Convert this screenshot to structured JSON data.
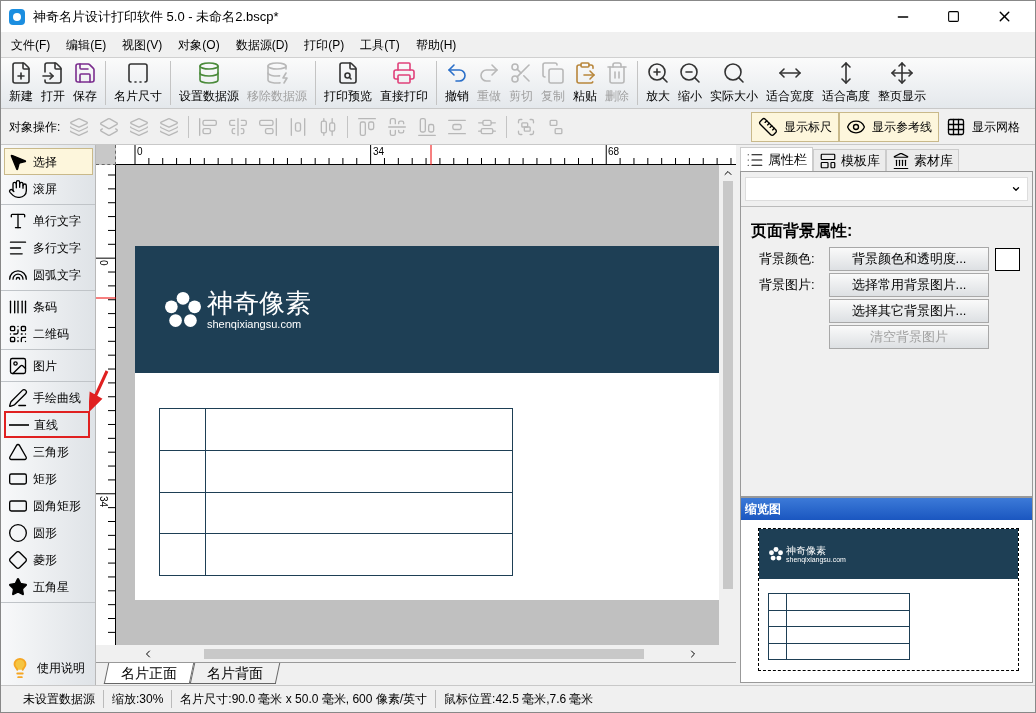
{
  "window": {
    "title": "神奇名片设计打印软件 5.0 - 未命名2.bscp*"
  },
  "menu": [
    "文件(F)",
    "编辑(E)",
    "视图(V)",
    "对象(O)",
    "数据源(D)",
    "打印(P)",
    "工具(T)",
    "帮助(H)"
  ],
  "toolbar": [
    [
      {
        "label": "新建",
        "disabled": false
      },
      {
        "label": "打开",
        "disabled": false
      },
      {
        "label": "保存",
        "disabled": false
      }
    ],
    [
      {
        "label": "名片尺寸",
        "disabled": false
      }
    ],
    [
      {
        "label": "设置数据源",
        "disabled": false
      },
      {
        "label": "移除数据源",
        "disabled": true
      }
    ],
    [
      {
        "label": "打印预览",
        "disabled": false
      },
      {
        "label": "直接打印",
        "disabled": false
      }
    ],
    [
      {
        "label": "撤销",
        "disabled": false
      },
      {
        "label": "重做",
        "disabled": true
      },
      {
        "label": "剪切",
        "disabled": true
      },
      {
        "label": "复制",
        "disabled": true
      },
      {
        "label": "粘贴",
        "disabled": false
      },
      {
        "label": "删除",
        "disabled": true
      }
    ],
    [
      {
        "label": "放大",
        "disabled": false
      },
      {
        "label": "缩小",
        "disabled": false
      },
      {
        "label": "实际大小",
        "disabled": false
      },
      {
        "label": "适合宽度",
        "disabled": false
      },
      {
        "label": "适合高度",
        "disabled": false
      },
      {
        "label": "整页显示",
        "disabled": false
      }
    ]
  ],
  "object_toolbar": {
    "label": "对象操作:",
    "groups": [
      [
        {
          "disabled": true
        },
        {
          "disabled": true
        },
        {
          "disabled": true
        },
        {
          "disabled": true
        }
      ],
      [
        {
          "disabled": true
        },
        {
          "disabled": true
        },
        {
          "disabled": true
        },
        {
          "disabled": true
        },
        {
          "disabled": true
        }
      ],
      [
        {
          "disabled": true
        },
        {
          "disabled": true
        },
        {
          "disabled": true
        },
        {
          "disabled": true
        },
        {
          "disabled": true
        }
      ],
      [
        {
          "disabled": true
        },
        {
          "disabled": true
        }
      ]
    ]
  },
  "view_toggles": [
    {
      "label": "显示标尺",
      "on": true
    },
    {
      "label": "显示参考线",
      "on": true
    },
    {
      "label": "显示网格",
      "on": false
    }
  ],
  "tools": [
    [
      {
        "label": "选择",
        "selected": true,
        "highlighted": false
      },
      {
        "label": "滚屏",
        "selected": false,
        "highlighted": false
      }
    ],
    [
      {
        "label": "单行文字",
        "selected": false,
        "highlighted": false
      },
      {
        "label": "多行文字",
        "selected": false,
        "highlighted": false
      },
      {
        "label": "圆弧文字",
        "selected": false,
        "highlighted": false
      }
    ],
    [
      {
        "label": "条码",
        "selected": false,
        "highlighted": false
      },
      {
        "label": "二维码",
        "selected": false,
        "highlighted": false
      }
    ],
    [
      {
        "label": "图片",
        "selected": false,
        "highlighted": false
      }
    ],
    [
      {
        "label": "手绘曲线",
        "selected": false,
        "highlighted": false
      },
      {
        "label": "直线",
        "selected": false,
        "highlighted": true
      },
      {
        "label": "三角形",
        "selected": false,
        "highlighted": false
      },
      {
        "label": "矩形",
        "selected": false,
        "highlighted": false
      },
      {
        "label": "圆角矩形",
        "selected": false,
        "highlighted": false
      },
      {
        "label": "圆形",
        "selected": false,
        "highlighted": false
      },
      {
        "label": "菱形",
        "selected": false,
        "highlighted": false
      },
      {
        "label": "五角星",
        "selected": false,
        "highlighted": false
      }
    ]
  ],
  "help_button": "使用说明",
  "rulers": {
    "horizontal": [
      "0",
      "34",
      "68"
    ],
    "vertical": [
      "0",
      "34"
    ]
  },
  "card": {
    "logo_text": "神奇像素",
    "logo_url": "shenqixiangsu.com"
  },
  "sheet_tabs": [
    {
      "label": "名片正面",
      "selected": true
    },
    {
      "label": "名片背面",
      "selected": false
    }
  ],
  "panel_tabs": [
    {
      "label": "属性栏",
      "selected": true
    },
    {
      "label": "模板库",
      "selected": false
    },
    {
      "label": "素材库",
      "selected": false
    }
  ],
  "properties": {
    "heading": "页面背景属性:",
    "rows": [
      {
        "label": "背景颜色:",
        "button": "背景颜色和透明度...",
        "disabled": false,
        "has_swatch": true
      },
      {
        "label": "背景图片:",
        "button": "选择常用背景图片...",
        "disabled": false,
        "has_swatch": false
      },
      {
        "button": "选择其它背景图片...",
        "disabled": false,
        "has_swatch": false
      },
      {
        "button": "清空背景图片",
        "disabled": true,
        "has_swatch": false
      }
    ]
  },
  "preview": {
    "title": "缩览图",
    "logo_text": "神奇像素",
    "logo_url": "shenqixiangsu.com"
  },
  "status_bar": [
    "未设置数据源",
    "缩放:30%",
    "名片尺寸:90.0 毫米 x 50.0 毫米, 600 像素/英寸",
    "鼠标位置:42.5 毫米,7.6 毫米"
  ]
}
